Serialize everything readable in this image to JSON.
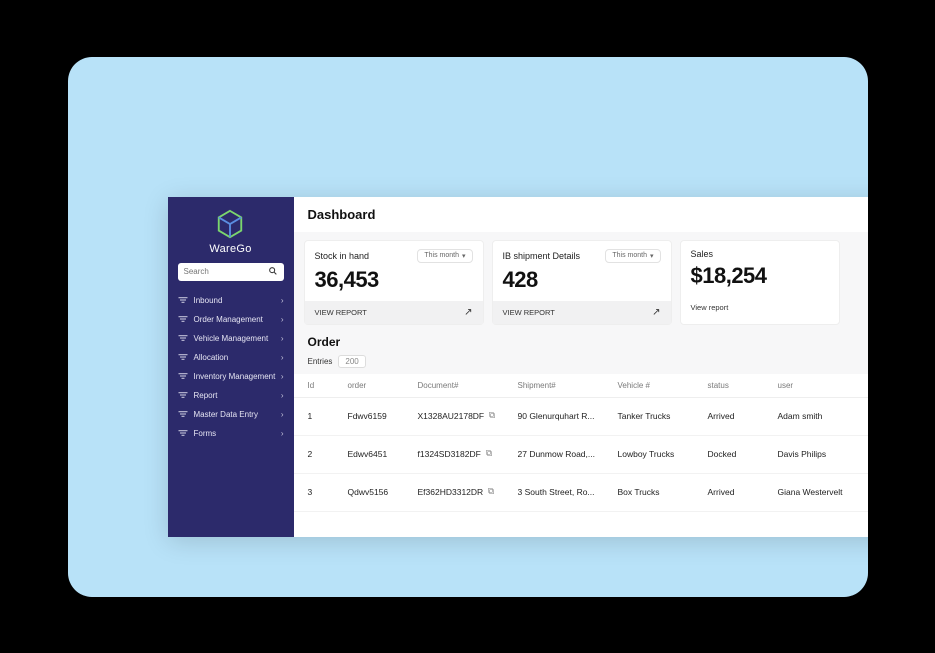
{
  "brand": {
    "name": "WareGo"
  },
  "search": {
    "placeholder": "Search"
  },
  "nav": {
    "items": [
      {
        "label": "Inbound"
      },
      {
        "label": "Order Management"
      },
      {
        "label": "Vehicle Management"
      },
      {
        "label": "Allocation"
      },
      {
        "label": "Inventory Management"
      },
      {
        "label": "Report"
      },
      {
        "label": "Master Data Entry"
      },
      {
        "label": "Forms"
      }
    ]
  },
  "page": {
    "title": "Dashboard"
  },
  "cards": [
    {
      "label": "Stock in hand",
      "range": "This month",
      "value": "36,453",
      "cta": "VIEW REPORT",
      "footer_style": "shaded"
    },
    {
      "label": "IB shipment Details",
      "range": "This month",
      "value": "428",
      "cta": "VIEW REPORT",
      "footer_style": "shaded"
    },
    {
      "label": "Sales",
      "range": "",
      "value": "$18,254",
      "cta": "View report",
      "footer_style": "plain"
    }
  ],
  "order_section": {
    "title": "Order",
    "entries_label": "Entries",
    "entries_count": "200"
  },
  "table": {
    "headers": [
      "Id",
      "order",
      "Document#",
      "Shipment#",
      "Vehicle #",
      "status",
      "user"
    ],
    "rows": [
      {
        "id": "1",
        "order": "Fdwv6159",
        "document": "X1328AU2178DF",
        "shipment": "90 Glenurquhart R...",
        "vehicle": "Tanker Trucks",
        "status": "Arrived",
        "user": "Adam smith"
      },
      {
        "id": "2",
        "order": "Edwv6451",
        "document": "f1324SD3182DF",
        "shipment": "27 Dunmow Road,...",
        "vehicle": "Lowboy Trucks",
        "status": "Docked",
        "user": "Davis Philips"
      },
      {
        "id": "3",
        "order": "Qdwv5156",
        "document": "Ef362HD3312DR",
        "shipment": "3 South Street, Ro...",
        "vehicle": "Box Trucks",
        "status": "Arrived",
        "user": "Giana Westervelt"
      }
    ]
  }
}
